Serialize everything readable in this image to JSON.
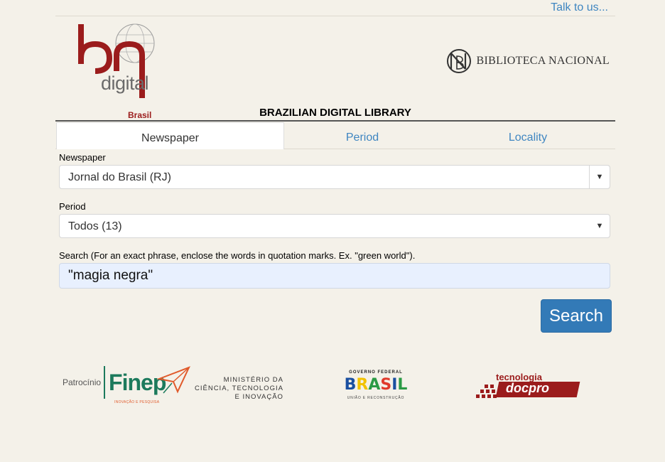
{
  "header": {
    "talk_link": "Talk to us...",
    "logo_digital": "digital",
    "logo_brasil": "Brasil",
    "library_name": "BIBLIOTECA NACIONAL",
    "site_title": "BRAZILIAN DIGITAL LIBRARY"
  },
  "tabs": [
    {
      "label": "Newspaper",
      "active": true
    },
    {
      "label": "Period",
      "active": false
    },
    {
      "label": "Locality",
      "active": false
    }
  ],
  "form": {
    "newspaper_label": "Newspaper",
    "newspaper_value": "Jornal do Brasil (RJ)",
    "period_label": "Period",
    "period_value": "Todos (13)",
    "search_label": "Search (For an exact phrase, enclose the words in quotation marks. Ex. \"green world\").",
    "search_value": "\"magia negra\"",
    "search_button": "Search"
  },
  "sponsors": {
    "patrocinio": "Patrocínio",
    "finep": "Finep",
    "finep_sub": "INOVAÇÃO E PESQUISA",
    "mcti_line1": "MINISTÉRIO DA",
    "mcti_line2": "CIÊNCIA, TECNOLOGIA",
    "mcti_line3": "E INOVAÇÃO",
    "gov_top": "GOVERNO FEDERAL",
    "gov_word": "BRASIL",
    "gov_bottom": "UNIÃO E RECONSTRUÇÃO",
    "docpro_top": "tecnologia",
    "docpro_word": "docpro"
  },
  "colors": {
    "accent": "#337ab7",
    "link": "#3f86c1",
    "brand_red": "#9b1c1c",
    "background": "#f4f1e9"
  }
}
